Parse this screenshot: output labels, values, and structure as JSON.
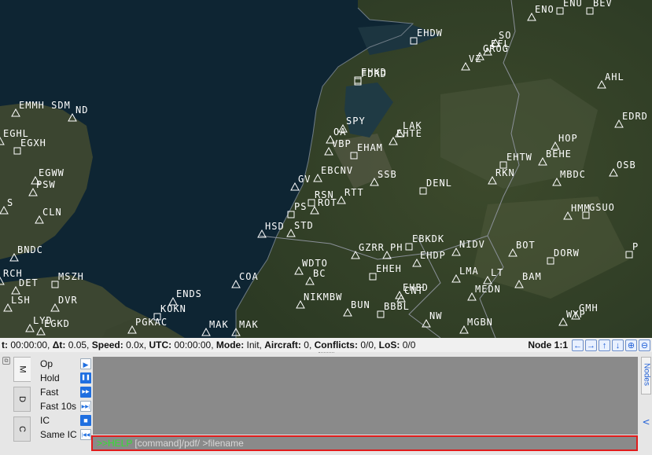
{
  "waypoints": [
    {
      "label": "ENO"
    },
    {
      "label": "EHDW"
    },
    {
      "label": "SO"
    },
    {
      "label": "EFL"
    },
    {
      "label": "GROG"
    },
    {
      "label": "VZ"
    },
    {
      "label": "AHL"
    },
    {
      "label": "EHKD"
    },
    {
      "label": "FDRD"
    },
    {
      "label": "SPY"
    },
    {
      "label": "OA"
    },
    {
      "label": "LAK"
    },
    {
      "label": "EHTE"
    },
    {
      "label": "EDRD"
    },
    {
      "label": "HOP"
    },
    {
      "label": "BEHE"
    },
    {
      "label": "EHTW"
    },
    {
      "label": "OSB"
    },
    {
      "label": "RKN"
    },
    {
      "label": "MBDC"
    },
    {
      "label": "VBP"
    },
    {
      "label": "EHAM"
    },
    {
      "label": "EBCNV"
    },
    {
      "label": "SSB"
    },
    {
      "label": "DENL"
    },
    {
      "label": "GV"
    },
    {
      "label": "RSN"
    },
    {
      "label": "RTT"
    },
    {
      "label": "ROT"
    },
    {
      "label": "PS"
    },
    {
      "label": "HMM"
    },
    {
      "label": "GSUO"
    },
    {
      "label": "HSD"
    },
    {
      "label": "STD"
    },
    {
      "label": "EBKDK"
    },
    {
      "label": "NIDV"
    },
    {
      "label": "BOT"
    },
    {
      "label": "DORW"
    },
    {
      "label": "P"
    },
    {
      "label": "GZRR"
    },
    {
      "label": "PH"
    },
    {
      "label": "EHDP"
    },
    {
      "label": "EHEH"
    },
    {
      "label": "WDTO"
    },
    {
      "label": "BC"
    },
    {
      "label": "COA"
    },
    {
      "label": "LMA"
    },
    {
      "label": "LT"
    },
    {
      "label": "BAM"
    },
    {
      "label": "EHBD"
    },
    {
      "label": "CNT"
    },
    {
      "label": "MEDN"
    },
    {
      "label": "ENDS"
    },
    {
      "label": "NIKMBW"
    },
    {
      "label": "BUN"
    },
    {
      "label": "BBBL"
    },
    {
      "label": "GMH"
    },
    {
      "label": "KOKN"
    },
    {
      "label": "WYP"
    },
    {
      "label": "NW"
    },
    {
      "label": "MAK"
    },
    {
      "label": "MAK"
    },
    {
      "label": "PGKAC"
    },
    {
      "label": "MGBN"
    },
    {
      "label": "EMMH SDM"
    },
    {
      "label": "ND"
    },
    {
      "label": "EGHL"
    },
    {
      "label": "EGXH"
    },
    {
      "label": "EGWW"
    },
    {
      "label": "PSW"
    },
    {
      "label": "S"
    },
    {
      "label": "CLN"
    },
    {
      "label": "BNDC"
    },
    {
      "label": "RCH"
    },
    {
      "label": "DET"
    },
    {
      "label": "MSZH"
    },
    {
      "label": "LSH"
    },
    {
      "label": "DVR"
    },
    {
      "label": "LYD"
    },
    {
      "label": "EGKD"
    },
    {
      "label": "ENU"
    },
    {
      "label": "BEV"
    }
  ],
  "status": {
    "sim_time_label": "t:",
    "sim_time": "00:00:00,",
    "dt_label": "Δt:",
    "dt": "0.05,",
    "speed_label": "Speed:",
    "speed": "0.0x,",
    "utc_label": "UTC:",
    "utc": "00:00:00,",
    "mode_label": "Mode:",
    "mode": "Init,",
    "aircraft_label": "Aircraft:",
    "aircraft": "0,",
    "conflicts_label": "Conflicts:",
    "conflicts": "0/0,",
    "los_label": "LoS:",
    "los": "0/0",
    "node": "Node 1:1"
  },
  "side_tabs": [
    "M",
    "D",
    "C"
  ],
  "commands": [
    {
      "label": "Op",
      "icon": "play-icon",
      "glyph": "▶"
    },
    {
      "label": "Hold",
      "icon": "pause-icon",
      "glyph": "❚❚"
    },
    {
      "label": "Fast",
      "icon": "fast-forward-icon",
      "glyph": "▶▶"
    },
    {
      "label": "Fast 10s",
      "icon": "skip-forward-icon",
      "glyph": "▶▶|"
    },
    {
      "label": "IC",
      "icon": "stop-icon",
      "glyph": "■"
    },
    {
      "label": "Same IC",
      "icon": "skip-back-icon",
      "glyph": "|◀◀"
    }
  ],
  "command_line": {
    "prompt": ">>HELP",
    "hint": "[command]/pdf/ >filename"
  },
  "right_tab": "Nodes",
  "colors": {
    "prompt": "#33e033",
    "console": "#8a8a8a",
    "highlight": "#e01b1b",
    "accent": "#1f6fe0"
  }
}
